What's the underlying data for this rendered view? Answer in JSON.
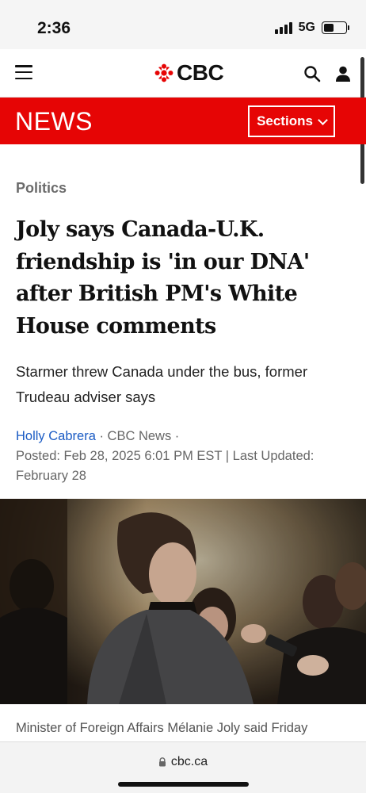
{
  "status_bar": {
    "time": "2:36",
    "network": "5G",
    "battery_level": 0.45
  },
  "header": {
    "logo_text": "CBC",
    "icons": [
      "menu-icon",
      "cbc-gem-icon",
      "search-icon",
      "user-icon"
    ]
  },
  "section_bar": {
    "title": "NEWS",
    "sections_label": "Sections",
    "background_color": "#e60505"
  },
  "article": {
    "category": "Politics",
    "headline": "Joly says Canada-U.K. friendship is 'in our DNA' after British PM's White House comments",
    "subhead": "Starmer threw Canada under the bus, former Trudeau adviser says",
    "author": "Holly Cabrera",
    "source": " · CBC News ·",
    "posted": "Posted: Feb 28, 2025 6:01 PM EST | Last Updated: February 28",
    "caption": "Minister of Foreign Affairs Mélanie Joly said Friday"
  },
  "browser": {
    "url": "cbc.ca"
  },
  "colors": {
    "accent": "#e60505",
    "link": "#1a5bc4"
  }
}
